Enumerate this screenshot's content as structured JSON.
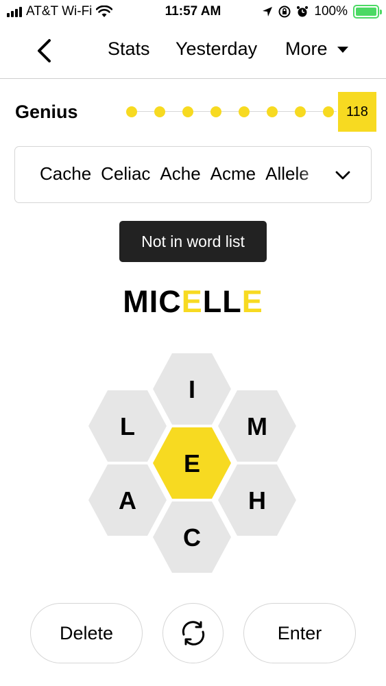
{
  "status_bar": {
    "carrier": "AT&T Wi-Fi",
    "time": "11:57 AM",
    "battery": "100%",
    "battery_color": "#4cd964"
  },
  "nav": {
    "back_icon": "chevron-left-icon",
    "stats": "Stats",
    "yesterday": "Yesterday",
    "more": "More"
  },
  "rank": {
    "label": "Genius",
    "score": "118",
    "dot_count": 8,
    "accent_color": "#f7da21"
  },
  "wordlist": {
    "words": [
      "Cache",
      "Celiac",
      "Ache",
      "Acme",
      "Allele"
    ],
    "expand_icon": "chevron-down-icon"
  },
  "toast": "Not in word list",
  "guess": {
    "prefix": "MIC",
    "letter1": "E",
    "middle": "LL",
    "letter2": "E"
  },
  "hive": {
    "center": "E",
    "top": "I",
    "upper_left": "L",
    "upper_right": "M",
    "lower_left": "A",
    "lower_right": "H",
    "bottom": "C",
    "center_color": "#f7da21",
    "outer_color": "#e6e6e6"
  },
  "buttons": {
    "delete": "Delete",
    "shuffle_icon": "shuffle-icon",
    "enter": "Enter"
  }
}
